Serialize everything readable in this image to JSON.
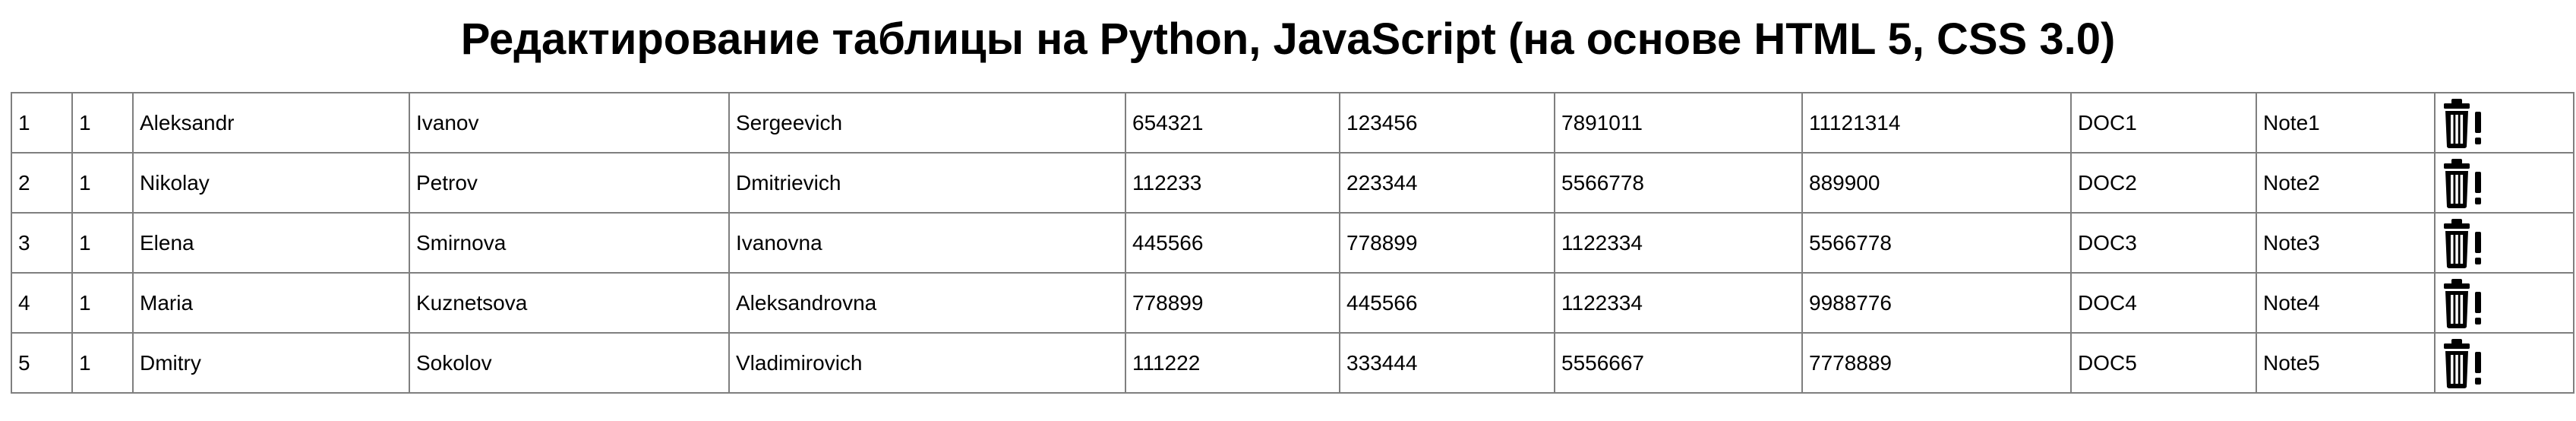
{
  "page": {
    "title": "Редактирование таблицы на Python, JavaScript (на основе HTML 5, CSS 3.0)"
  },
  "table": {
    "rows": [
      {
        "id": "1",
        "group": "1",
        "first_name": "Aleksandr",
        "last_name": "Ivanov",
        "patronymic": "Sergeevich",
        "c1": "654321",
        "c2": "123456",
        "c3": "7891011",
        "c4": "11121314",
        "doc": "DOC1",
        "note": "Note1"
      },
      {
        "id": "2",
        "group": "1",
        "first_name": "Nikolay",
        "last_name": "Petrov",
        "patronymic": "Dmitrievich",
        "c1": "112233",
        "c2": "223344",
        "c3": "5566778",
        "c4": "889900",
        "doc": "DOC2",
        "note": "Note2"
      },
      {
        "id": "3",
        "group": "1",
        "first_name": "Elena",
        "last_name": "Smirnova",
        "patronymic": "Ivanovna",
        "c1": "445566",
        "c2": "778899",
        "c3": "1122334",
        "c4": "5566778",
        "doc": "DOC3",
        "note": "Note3"
      },
      {
        "id": "4",
        "group": "1",
        "first_name": "Maria",
        "last_name": "Kuznetsova",
        "patronymic": "Aleksandrovna",
        "c1": "778899",
        "c2": "445566",
        "c3": "1122334",
        "c4": "9988776",
        "doc": "DOC4",
        "note": "Note4"
      },
      {
        "id": "5",
        "group": "1",
        "first_name": "Dmitry",
        "last_name": "Sokolov",
        "patronymic": "Vladimirovich",
        "c1": "111222",
        "c2": "333444",
        "c3": "5556667",
        "c4": "7778889",
        "doc": "DOC5",
        "note": "Note5"
      }
    ],
    "row_action_icon": "trash-exclamation-icon"
  }
}
